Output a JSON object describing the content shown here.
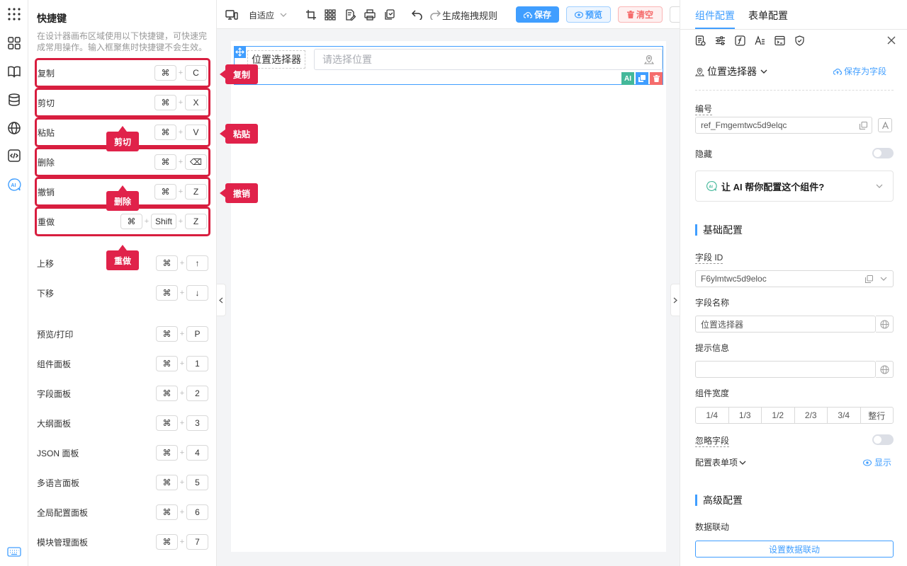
{
  "left_panel": {
    "title": "快捷键",
    "description": "在设计器画布区域使用以下快捷键，可快速完成常用操作。输入框聚焦时快捷键不会生效。",
    "shortcuts": [
      {
        "label": "复制",
        "keys": [
          "⌘",
          "C"
        ]
      },
      {
        "label": "剪切",
        "keys": [
          "⌘",
          "X"
        ]
      },
      {
        "label": "粘贴",
        "keys": [
          "⌘",
          "V"
        ]
      },
      {
        "label": "删除",
        "keys": [
          "⌘",
          "⌫"
        ]
      },
      {
        "label": "撤销",
        "keys": [
          "⌘",
          "Z"
        ]
      },
      {
        "label": "重做",
        "keys": [
          "⌘",
          "Shift",
          "Z"
        ]
      },
      {
        "label": "上移",
        "keys": [
          "⌘",
          "↑"
        ]
      },
      {
        "label": "下移",
        "keys": [
          "⌘",
          "↓"
        ]
      },
      {
        "label": "预览/打印",
        "keys": [
          "⌘",
          "P"
        ]
      },
      {
        "label": "组件面板",
        "keys": [
          "⌘",
          "1"
        ]
      },
      {
        "label": "字段面板",
        "keys": [
          "⌘",
          "2"
        ]
      },
      {
        "label": "大纲面板",
        "keys": [
          "⌘",
          "3"
        ]
      },
      {
        "label": "JSON 面板",
        "keys": [
          "⌘",
          "4"
        ]
      },
      {
        "label": "多语言面板",
        "keys": [
          "⌘",
          "5"
        ]
      },
      {
        "label": "全局配置面板",
        "keys": [
          "⌘",
          "6"
        ]
      },
      {
        "label": "模块管理面板",
        "keys": [
          "⌘",
          "7"
        ]
      }
    ],
    "plus": "+"
  },
  "annotations": {
    "copy": "复制",
    "cut": "剪切",
    "paste": "粘贴",
    "delete": "删除",
    "undo": "撤销",
    "redo": "重做"
  },
  "toolbar": {
    "device_select": "自适应",
    "rule_label": "生成拖拽规则",
    "save": "保存",
    "preview": "预览",
    "clear": "清空"
  },
  "canvas": {
    "component_label": "位置选择器",
    "component_placeholder": "请选择位置",
    "ai_badge": "AI"
  },
  "right_panel": {
    "tabs": [
      "组件配置",
      "表单配置"
    ],
    "component_type": "位置选择器",
    "save_as_field": "保存为字段",
    "id_label": "编号",
    "id_value": "ref_Fmgemtwc5d9elqc",
    "hidden_label": "隐藏",
    "ai_prompt": "让 AI 帮你配置这个组件?",
    "basic_section": "基础配置",
    "field_id_label": "字段 ID",
    "field_id_value": "F6ylmtwc5d9eloc",
    "field_name_label": "字段名称",
    "field_name_value": "位置选择器",
    "hint_label": "提示信息",
    "hint_value": "",
    "width_label": "组件宽度",
    "widths": [
      "1/4",
      "1/3",
      "1/2",
      "2/3",
      "3/4",
      "整行"
    ],
    "ignore_label": "忽略字段",
    "form_item_label": "配置表单项",
    "show_label": "显示",
    "advanced_section": "高级配置",
    "linkage_label": "数据联动",
    "linkage_button": "设置数据联动"
  },
  "colors": {
    "accent": "#409eff",
    "annotation": "#e0224a",
    "danger": "#f56c6c"
  }
}
